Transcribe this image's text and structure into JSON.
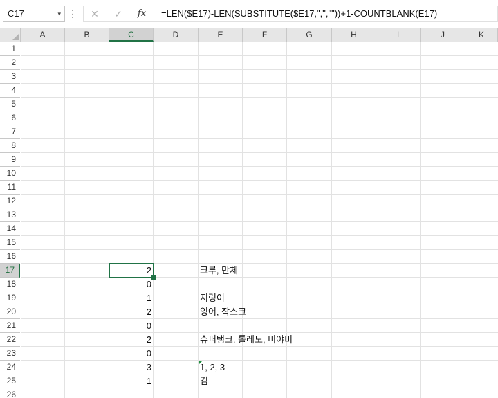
{
  "formula_bar": {
    "name_box": "C17",
    "name_box_caret": "▾",
    "cancel_glyph": "✕",
    "enter_glyph": "✓",
    "fx_glyph": "fx",
    "formula": "=LEN($E17)-LEN(SUBSTITUTE($E17,\",\",\"\"))+1-COUNTBLANK(E17)"
  },
  "columns": [
    "A",
    "B",
    "C",
    "D",
    "E",
    "F",
    "G",
    "H",
    "I",
    "J",
    "K"
  ],
  "rows": [
    "1",
    "2",
    "3",
    "4",
    "5",
    "6",
    "7",
    "8",
    "9",
    "10",
    "11",
    "12",
    "13",
    "14",
    "15",
    "16",
    "17",
    "18",
    "19",
    "20",
    "21",
    "22",
    "23",
    "24",
    "25",
    "26"
  ],
  "cells": {
    "c17": "2",
    "e17": "크루, 만체",
    "c18": "0",
    "c19": "1",
    "e19": "지렁이",
    "c20": "2",
    "e20": "잉어, 작스크",
    "c21": "0",
    "c22": "2",
    "e22": "슈퍼탱크. 톨레도, 미야비",
    "c23": "0",
    "c24": "3",
    "e24": "1, 2, 3",
    "c25": "1",
    "e25": "김"
  },
  "selection": {
    "active_cell": "C17",
    "accent_color": "#217346"
  }
}
